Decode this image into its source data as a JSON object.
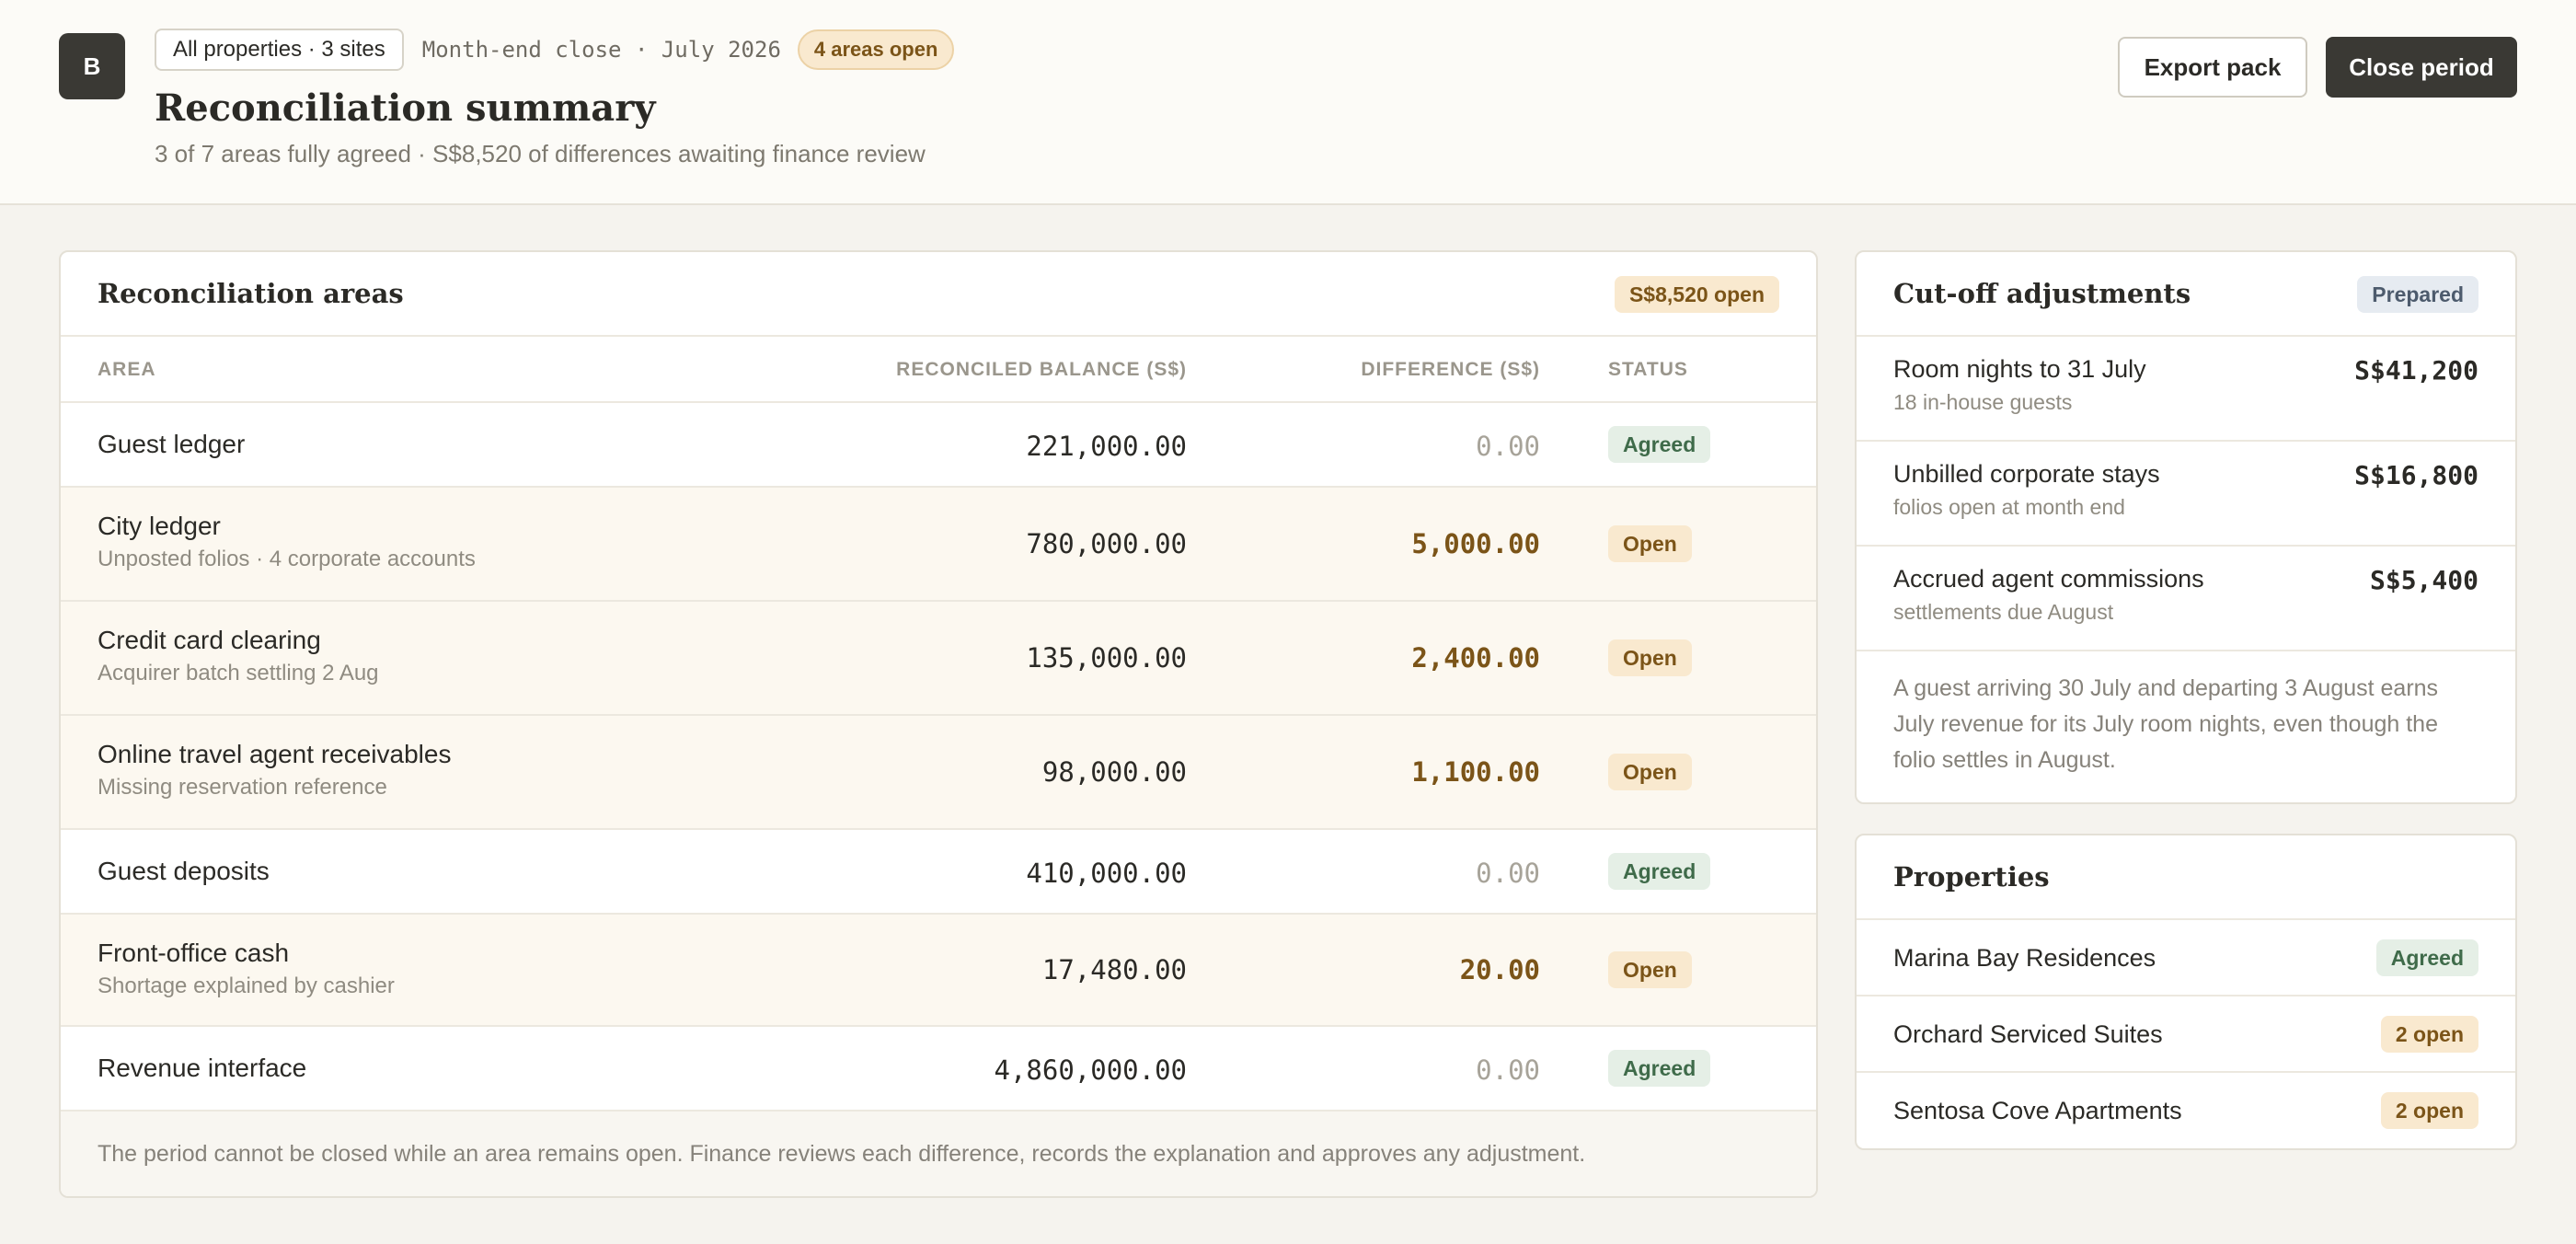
{
  "header": {
    "logo_letter": "B",
    "property_selector": "All properties · 3 sites",
    "period": "Month-end close · July 2026",
    "open_badge": "4 areas open",
    "title": "Reconciliation summary",
    "subtitle": "3 of 7 areas fully agreed · S$8,520 of differences awaiting finance review",
    "export_label": "Export pack",
    "close_label": "Close period"
  },
  "areas": {
    "title": "Reconciliation areas",
    "badge": "S$8,520 open",
    "columns": {
      "area": "AREA",
      "balance": "RECONCILED BALANCE (S$)",
      "difference": "DIFFERENCE (S$)",
      "status": "STATUS"
    },
    "rows": [
      {
        "name": "Guest ledger",
        "sub": "",
        "balance": "221,000.00",
        "difference": "0.00",
        "status": "Agreed"
      },
      {
        "name": "City ledger",
        "sub": "Unposted folios · 4 corporate accounts",
        "balance": "780,000.00",
        "difference": "5,000.00",
        "status": "Open"
      },
      {
        "name": "Credit card clearing",
        "sub": "Acquirer batch settling 2 Aug",
        "balance": "135,000.00",
        "difference": "2,400.00",
        "status": "Open"
      },
      {
        "name": "Online travel agent receivables",
        "sub": "Missing reservation reference",
        "balance": "98,000.00",
        "difference": "1,100.00",
        "status": "Open"
      },
      {
        "name": "Guest deposits",
        "sub": "",
        "balance": "410,000.00",
        "difference": "0.00",
        "status": "Agreed"
      },
      {
        "name": "Front-office cash",
        "sub": "Shortage explained by cashier",
        "balance": "17,480.00",
        "difference": "20.00",
        "status": "Open"
      },
      {
        "name": "Revenue interface",
        "sub": "",
        "balance": "4,860,000.00",
        "difference": "0.00",
        "status": "Agreed"
      }
    ],
    "footer": "The period cannot be closed while an area remains open. Finance reviews each difference, records the explanation and approves any adjustment."
  },
  "cutoff": {
    "title": "Cut-off adjustments",
    "badge": "Prepared",
    "items": [
      {
        "name": "Room nights to 31 July",
        "sub": "18 in-house guests",
        "amount": "S$41,200"
      },
      {
        "name": "Unbilled corporate stays",
        "sub": "folios open at month end",
        "amount": "S$16,800"
      },
      {
        "name": "Accrued agent commissions",
        "sub": "settlements due August",
        "amount": "S$5,400"
      }
    ],
    "note": "A guest arriving 30 July and departing 3 August earns July revenue for its July room nights, even though the folio settles in August."
  },
  "properties": {
    "title": "Properties",
    "items": [
      {
        "name": "Marina Bay Residences",
        "status": "Agreed"
      },
      {
        "name": "Orchard Serviced Suites",
        "status": "2 open"
      },
      {
        "name": "Sentosa Cove Apartments",
        "status": "2 open"
      }
    ]
  }
}
